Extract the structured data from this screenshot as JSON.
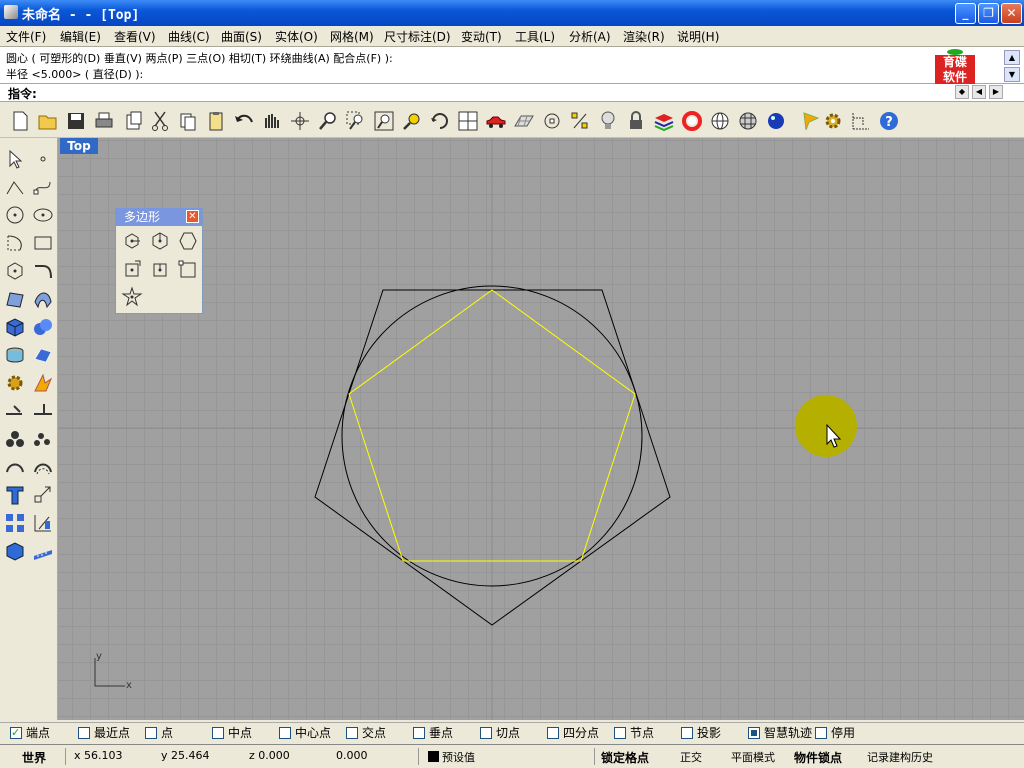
{
  "window": {
    "title": "未命名 - - [Top]",
    "minimize": "_",
    "restore": "❐",
    "close": "✕"
  },
  "menubar": {
    "items": [
      "文件(F)",
      "编辑(E)",
      "查看(V)",
      "曲线(C)",
      "曲面(S)",
      "实体(O)",
      "网格(M)",
      "尺寸标注(D)",
      "变动(T)",
      "工具(L)",
      "分析(A)",
      "渲染(R)",
      "说明(H)"
    ]
  },
  "command": {
    "line1": "圆心 ( 可塑形的(D) 垂直(V) 两点(P) 三点(O) 相切(T) 环绕曲线(A) 配合点(F) ):",
    "line2": "半径 <5.000> ( 直径(D) ):",
    "prompt_label": "指令:",
    "logo_top": "育碟",
    "logo_bottom": "软件"
  },
  "toolbar": {
    "icons": [
      "new-icon",
      "open-icon",
      "save-icon",
      "print-icon",
      "copy-props-icon",
      "cut-icon",
      "copy-icon",
      "paste-icon",
      "undo-icon",
      "pan-icon",
      "rotate-view-icon",
      "zoom-icon",
      "zoom-window-icon",
      "zoom-extents-icon",
      "zoom-selected-icon",
      "rotate-icon",
      "viewport-layout-icon",
      "car-icon",
      "grid-plane-icon",
      "osnap-icon",
      "points-icon",
      "light-icon",
      "lock-icon",
      "layers-icon",
      "color-icon",
      "sphere-wire-icon",
      "sphere-grid-icon",
      "render-sphere-icon",
      "pen-icon",
      "settings-icon",
      "dimension-icon",
      "help-icon"
    ]
  },
  "viewport": {
    "title": "Top",
    "axis_x": "x",
    "axis_y": "y"
  },
  "polygon_panel": {
    "title": "多边形",
    "close": "✕"
  },
  "osnap": {
    "items": [
      {
        "label": "端点",
        "checked": true
      },
      {
        "label": "最近点",
        "checked": false
      },
      {
        "label": "点",
        "checked": false
      },
      {
        "label": "中点",
        "checked": false
      },
      {
        "label": "中心点",
        "checked": false
      },
      {
        "label": "交点",
        "checked": false
      },
      {
        "label": "垂点",
        "checked": false
      },
      {
        "label": "切点",
        "checked": false
      },
      {
        "label": "四分点",
        "checked": false
      },
      {
        "label": "节点",
        "checked": false
      },
      {
        "label": "投影",
        "checked": false
      },
      {
        "label": "智慧轨迹",
        "checked": true
      },
      {
        "label": "停用",
        "checked": false
      }
    ]
  },
  "status": {
    "cplane": "世界",
    "x": "x 56.103",
    "y": "y 25.464",
    "z": "z 0.000",
    "distance": "0.000",
    "layer": "预设值",
    "grid_snap": "锁定格点",
    "ortho": "正交",
    "planar": "平面模式",
    "osnap": "物件锁点",
    "history": "记录建构历史"
  },
  "colors": {
    "title_bar": "#0a57d8",
    "viewport_bg": "#a0a0a0",
    "polygon_yellow": "#ffff00",
    "cursor_highlight": "#b5b000"
  }
}
